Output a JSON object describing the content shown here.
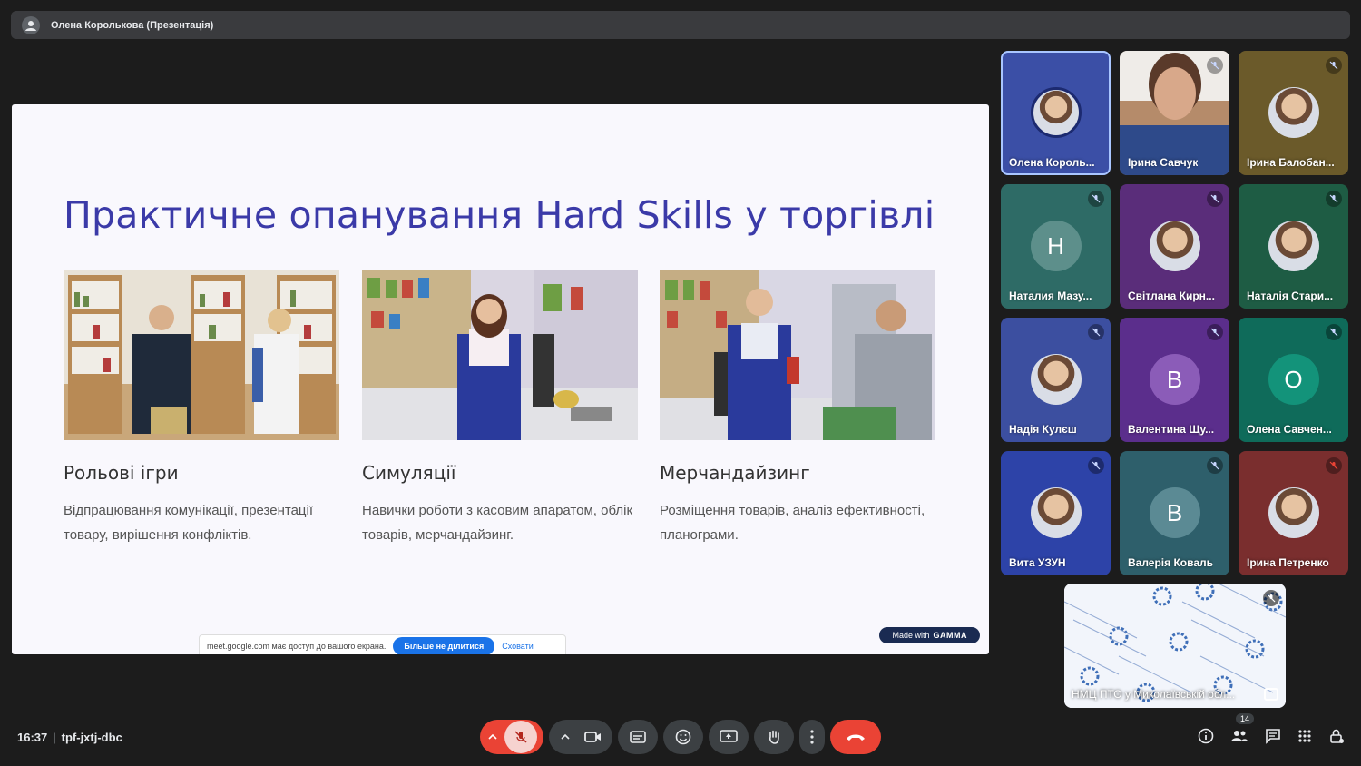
{
  "presenter": {
    "title": "Олена Королькова (Презентація)"
  },
  "slide": {
    "title": "Практичне опанування Hard Skills у торгівлі",
    "cards": [
      {
        "heading": "Рольові ігри",
        "text": "Відпрацювання комунікації, презентації товару, вирішення конфліктів."
      },
      {
        "heading": "Симуляції",
        "text": "Навички роботи з касовим апаратом, облік товарів, мерчандайзинг."
      },
      {
        "heading": "Мерчандайзинг",
        "text": "Розміщення товарів, аналіз ефективності, планограми."
      }
    ],
    "gamma_prefix": "Made with",
    "gamma_brand": "GAMMA"
  },
  "share_notice": {
    "text": "meet.google.com має доступ до вашого екрана.",
    "stop_label": "Більше не ділитися",
    "hide_label": "Сховати"
  },
  "participants": [
    {
      "name": "Олена Король...",
      "kind": "photo",
      "bg": "#3b4fa6",
      "active": true,
      "mic": "none"
    },
    {
      "name": "Ірина Савчук",
      "kind": "video",
      "bg": "#8a6b55",
      "mic": "muted"
    },
    {
      "name": "Ірина Балобан...",
      "kind": "photo",
      "bg": "#6b5a2a",
      "mic": "muted"
    },
    {
      "name": "Наталия Мазу...",
      "kind": "letter",
      "letter": "Н",
      "bg": "#2e6b66",
      "circle": "#5d8f8b",
      "mic": "muted"
    },
    {
      "name": "Світлана Кирн...",
      "kind": "photo",
      "bg": "#5a2d7a",
      "mic": "muted"
    },
    {
      "name": "Наталія Стари...",
      "kind": "photo",
      "bg": "#1e5c44",
      "mic": "muted"
    },
    {
      "name": "Надія Кулєш",
      "kind": "photo",
      "bg": "#3c4fa0",
      "mic": "muted"
    },
    {
      "name": "Валентина Щу...",
      "kind": "letter",
      "letter": "В",
      "bg": "#5b2e8c",
      "circle": "#8b5cb8",
      "mic": "muted"
    },
    {
      "name": "Олена Савчен...",
      "kind": "letter",
      "letter": "О",
      "bg": "#0f6b5a",
      "circle": "#13937a",
      "mic": "muted"
    },
    {
      "name": "Вита УЗУН",
      "kind": "photo",
      "bg": "#2d43a8",
      "mic": "muted"
    },
    {
      "name": "Валерія Коваль",
      "kind": "letter",
      "letter": "В",
      "bg": "#2e5f6b",
      "circle": "#5b8a94",
      "mic": "muted"
    },
    {
      "name": "Ірина Петренко",
      "kind": "photo",
      "bg": "#7a2e2e",
      "mic": "muted-red"
    }
  ],
  "self_view": {
    "name": "НМЦ ПТО у Миколаївській обл..."
  },
  "meeting": {
    "time": "16:37",
    "code": "tpf-jxtj-dbc"
  },
  "participants_count": "14",
  "colors": {
    "end_call": "#ea4335",
    "slide_title": "#3b3aa8",
    "active_outline": "#a9c6ff"
  }
}
